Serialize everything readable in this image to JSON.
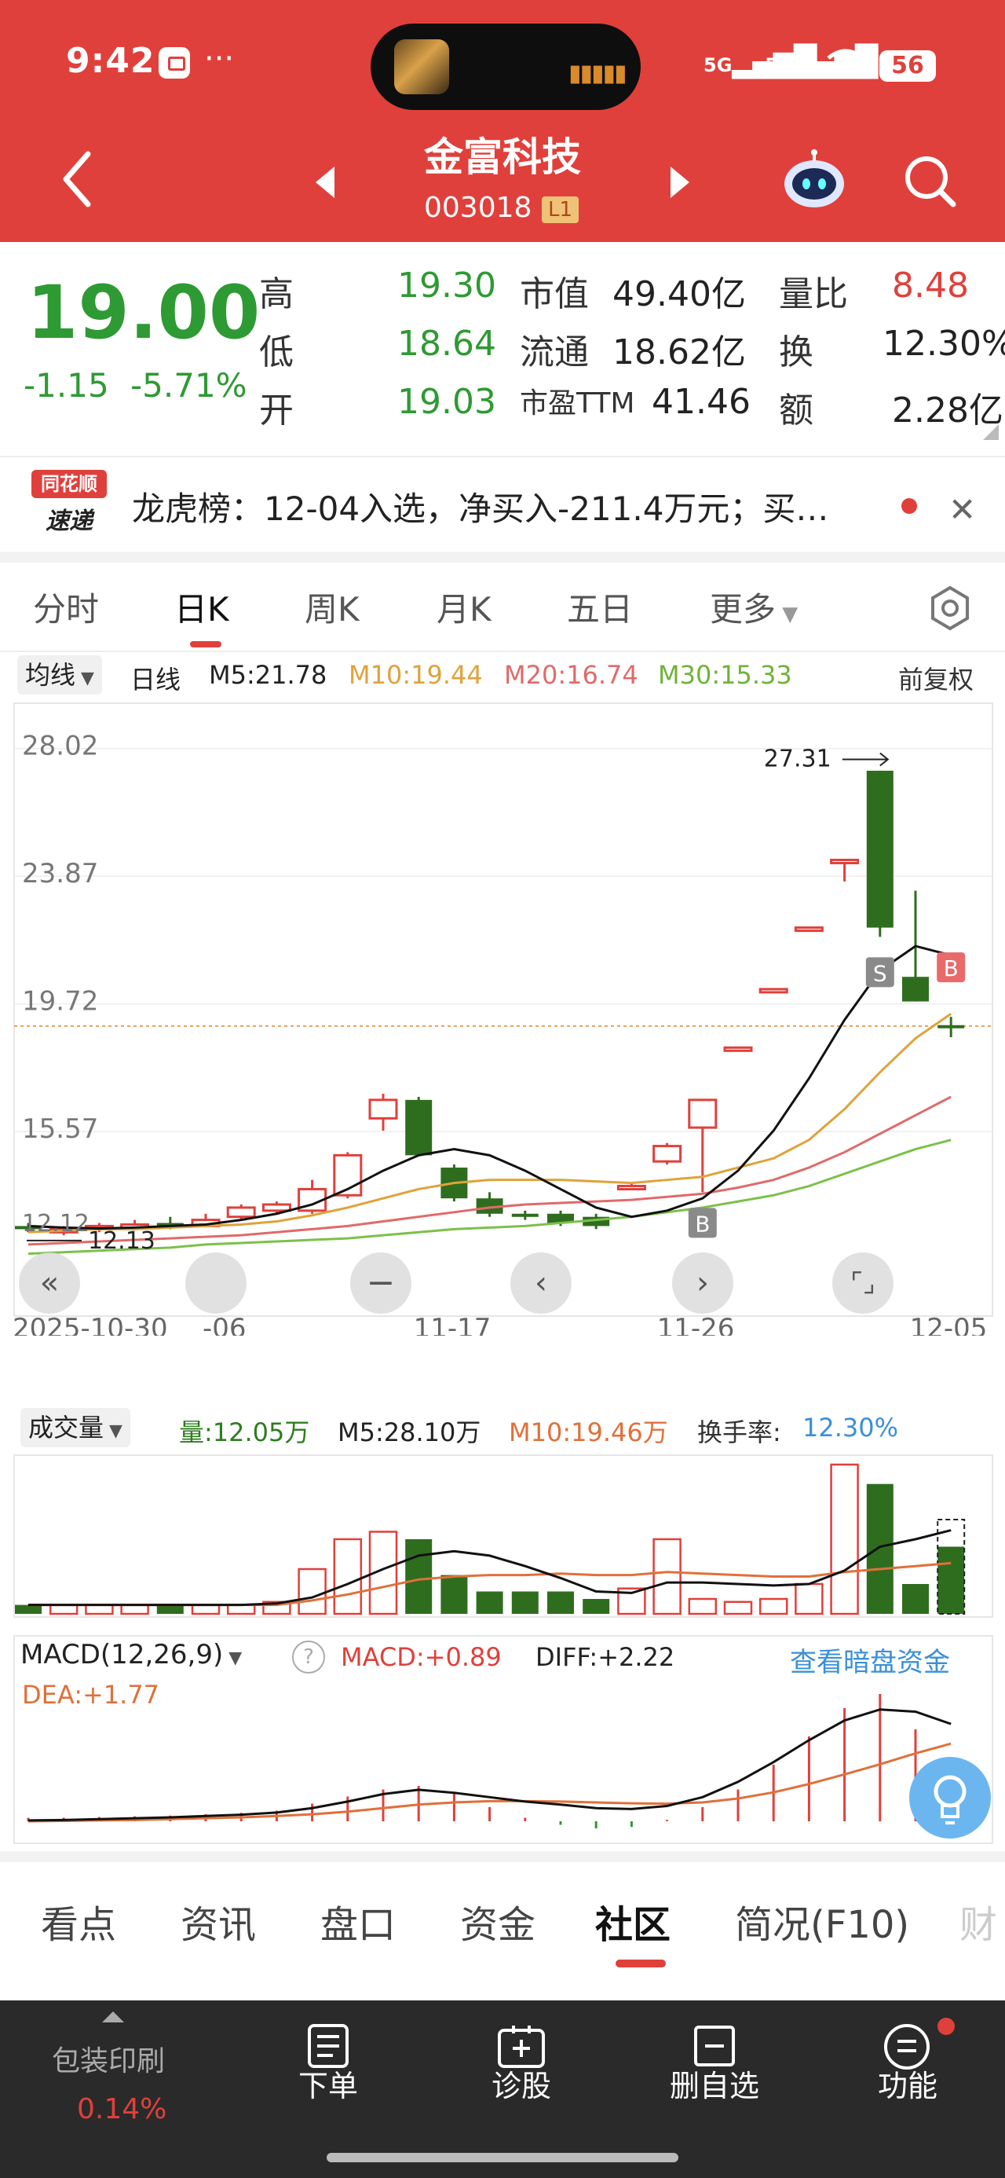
{
  "status": {
    "time": "9:42",
    "battery": "56",
    "network": "5G"
  },
  "header": {
    "title": "金富科技",
    "code": "003018",
    "level_badge": "L1"
  },
  "quote": {
    "price": "19.00",
    "change": "-1.15",
    "change_pct": "-5.71%",
    "rows": [
      {
        "l1": "高",
        "v1": "19.30",
        "l2": "市值",
        "v2": "49.40亿",
        "l3": "量比",
        "v3": "8.48"
      },
      {
        "l1": "低",
        "v1": "18.64",
        "l2": "流通",
        "v2": "18.62亿",
        "l3": "换",
        "v3": "12.30%"
      },
      {
        "l1": "开",
        "v1": "19.03",
        "l2": "市盈TTM",
        "v2": "41.46",
        "l3": "额",
        "v3": "2.28亿"
      }
    ]
  },
  "news": {
    "logo_top": "同花顺",
    "logo_bottom": "速递",
    "text": "龙虎榜：12-04入选，净买入-211.4万元；买…"
  },
  "tabs": [
    "分时",
    "日K",
    "周K",
    "月K",
    "五日",
    "更多"
  ],
  "active_tab": "日K",
  "ma_legend": {
    "type": "均线",
    "period": "日线",
    "m5": "M5:21.78",
    "m10": "M10:19.44",
    "m20": "M20:16.74",
    "m30": "M30:15.33",
    "adjust": "前复权"
  },
  "colors": {
    "up": "#e0403b",
    "down": "#2f6d1e",
    "m5": "#111111",
    "m10": "#e0a23a",
    "m20": "#e06a6a",
    "m30": "#7cc04a",
    "header": "#e0403b"
  },
  "chart_data": {
    "type": "candlestick",
    "y_ticks": [
      "28.02",
      "23.87",
      "19.72",
      "15.57"
    ],
    "ylim": [
      12.0,
      28.6
    ],
    "x_labels": [
      "2025-10-30",
      "-06",
      "11-17",
      "11-26",
      "12-05"
    ],
    "high_marker": "27.31",
    "low_marker": "12.13",
    "low_left": "12.12",
    "candles": [
      {
        "o": 12.5,
        "c": 12.4,
        "h": 12.6,
        "l": 12.3
      },
      {
        "o": 12.3,
        "c": 12.4,
        "h": 12.5,
        "l": 12.2
      },
      {
        "o": 12.4,
        "c": 12.5,
        "h": 12.6,
        "l": 12.3
      },
      {
        "o": 12.45,
        "c": 12.55,
        "h": 12.7,
        "l": 12.4
      },
      {
        "o": 12.6,
        "c": 12.45,
        "h": 12.8,
        "l": 12.4
      },
      {
        "o": 12.5,
        "c": 12.7,
        "h": 12.9,
        "l": 12.5
      },
      {
        "o": 12.8,
        "c": 13.1,
        "h": 13.2,
        "l": 12.7
      },
      {
        "o": 13.0,
        "c": 13.2,
        "h": 13.3,
        "l": 12.9
      },
      {
        "o": 13.0,
        "c": 13.7,
        "h": 14.0,
        "l": 12.9
      },
      {
        "o": 13.5,
        "c": 14.8,
        "h": 14.9,
        "l": 13.4
      },
      {
        "o": 16.0,
        "c": 16.6,
        "h": 16.8,
        "l": 15.6
      },
      {
        "o": 16.6,
        "c": 14.8,
        "h": 16.7,
        "l": 14.8
      },
      {
        "o": 14.4,
        "c": 13.4,
        "h": 14.5,
        "l": 13.3
      },
      {
        "o": 13.4,
        "c": 12.9,
        "h": 13.6,
        "l": 12.8
      },
      {
        "o": 12.9,
        "c": 12.8,
        "h": 13.0,
        "l": 12.7
      },
      {
        "o": 12.9,
        "c": 12.6,
        "h": 13.0,
        "l": 12.5
      },
      {
        "o": 12.8,
        "c": 12.5,
        "h": 12.9,
        "l": 12.4
      },
      {
        "o": 13.8,
        "c": 13.8,
        "h": 13.9,
        "l": 13.7
      },
      {
        "o": 14.6,
        "c": 15.1,
        "h": 15.2,
        "l": 14.5
      },
      {
        "o": 15.7,
        "c": 16.6,
        "h": 16.6,
        "l": 13.6
      },
      {
        "o": 18.3,
        "c": 18.3,
        "h": 18.3,
        "l": 18.3
      },
      {
        "o": 20.2,
        "c": 20.2,
        "h": 20.2,
        "l": 20.2
      },
      {
        "o": 22.2,
        "c": 22.2,
        "h": 22.2,
        "l": 22.2
      },
      {
        "o": 24.4,
        "c": 24.4,
        "h": 24.4,
        "l": 23.7
      },
      {
        "o": 27.3,
        "c": 22.2,
        "h": 27.3,
        "l": 21.9
      },
      {
        "o": 20.6,
        "c": 19.8,
        "h": 23.4,
        "l": 19.8
      },
      {
        "o": 19.03,
        "c": 19.0,
        "h": 19.3,
        "l": 18.64
      }
    ],
    "ma5": [
      12.5,
      12.45,
      12.42,
      12.45,
      12.5,
      12.55,
      12.7,
      12.9,
      13.2,
      13.7,
      14.3,
      14.8,
      15.0,
      14.8,
      14.3,
      13.7,
      13.1,
      12.8,
      13.0,
      13.4,
      14.3,
      15.6,
      17.3,
      19.2,
      20.8,
      21.6,
      21.3
    ],
    "ma10": [
      12.3,
      12.35,
      12.4,
      12.4,
      12.45,
      12.5,
      12.55,
      12.65,
      12.85,
      13.1,
      13.4,
      13.7,
      13.9,
      14.0,
      14.0,
      14.0,
      13.95,
      13.9,
      14.0,
      14.1,
      14.4,
      14.7,
      15.3,
      16.3,
      17.5,
      18.6,
      19.4
    ],
    "ma20": [
      11.9,
      11.95,
      12.0,
      12.05,
      12.1,
      12.15,
      12.2,
      12.3,
      12.4,
      12.5,
      12.65,
      12.8,
      12.95,
      13.1,
      13.2,
      13.25,
      13.3,
      13.35,
      13.45,
      13.55,
      13.75,
      14.0,
      14.4,
      14.9,
      15.5,
      16.1,
      16.7
    ],
    "ma30": [
      11.6,
      11.65,
      11.7,
      11.75,
      11.8,
      11.9,
      11.95,
      12.0,
      12.05,
      12.1,
      12.2,
      12.3,
      12.4,
      12.45,
      12.5,
      12.6,
      12.7,
      12.8,
      12.95,
      13.1,
      13.3,
      13.5,
      13.8,
      14.2,
      14.6,
      15.0,
      15.3
    ],
    "signals": [
      {
        "i": 19,
        "label": "B"
      },
      {
        "i": 24,
        "label": "S"
      },
      {
        "i": 26,
        "label": "B"
      }
    ]
  },
  "volume": {
    "selector": "成交量",
    "vol": "量:12.05万",
    "m5": "M5:28.10万",
    "m10": "M10:19.46万",
    "turnover_label": "换手率:",
    "turnover": "12.30%",
    "bars": [
      0.6,
      0.6,
      0.6,
      0.6,
      0.6,
      0.6,
      0.6,
      0.8,
      3.0,
      5.0,
      5.5,
      5.0,
      2.6,
      1.5,
      1.5,
      1.5,
      1.0,
      1.7,
      5.0,
      1.0,
      0.8,
      1.0,
      2.0,
      10.0,
      8.7,
      2.0,
      4.5
    ]
  },
  "macd": {
    "selector": "MACD(12,26,9)",
    "macd": "MACD:+0.89",
    "diff": "DIFF:+2.22",
    "dea": "DEA:+1.77",
    "link": "查看暗盘资金",
    "hist": [
      0.05,
      0.05,
      0.06,
      0.07,
      0.08,
      0.1,
      0.12,
      0.15,
      0.25,
      0.35,
      0.45,
      0.5,
      0.4,
      0.2,
      0.05,
      -0.05,
      -0.1,
      -0.08,
      0.02,
      0.2,
      0.45,
      0.8,
      1.2,
      1.6,
      1.8,
      1.3,
      0.89
    ]
  },
  "bottom_tabs": [
    "看点",
    "资讯",
    "盘口",
    "资金",
    "社区",
    "简况(F10)",
    "财"
  ],
  "bottom_active": "社区",
  "bottom_bar": {
    "sector": "包装印刷",
    "sector_pct": "0.14%",
    "items": [
      "下单",
      "诊股",
      "删自选",
      "功能"
    ]
  }
}
